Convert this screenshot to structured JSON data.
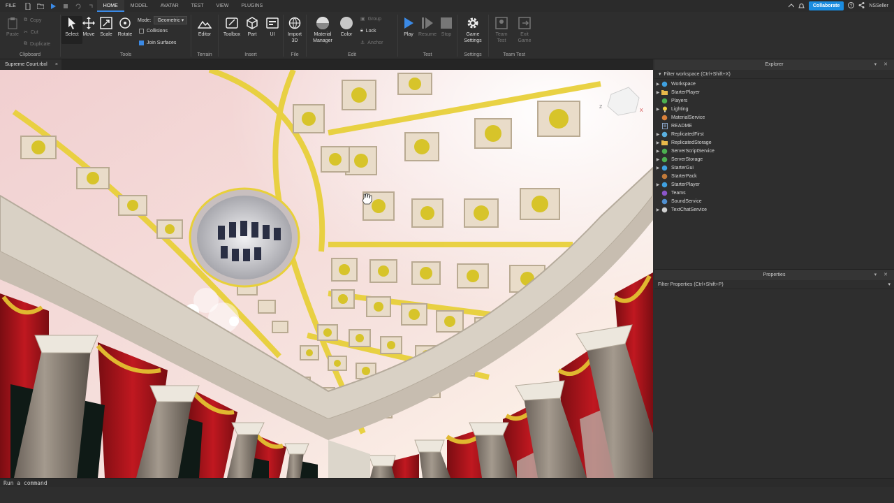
{
  "menubar": {
    "file_label": "FILE",
    "tabs": [
      "HOME",
      "MODEL",
      "AVATAR",
      "TEST",
      "VIEW",
      "PLUGINS"
    ],
    "collaborate_label": "Collaborate",
    "username": "NSSeller"
  },
  "ribbon": {
    "clipboard": {
      "paste": "Paste",
      "copy": "Copy",
      "cut": "Cut",
      "duplicate": "Duplicate",
      "label": "Clipboard"
    },
    "tools": {
      "select": "Select",
      "move": "Move",
      "scale": "Scale",
      "rotate": "Rotate",
      "mode_label": "Mode:",
      "mode_value": "Geometric",
      "collisions": "Collisions",
      "join_surfaces": "Join Surfaces",
      "label": "Tools"
    },
    "terrain": {
      "editor": "Editor",
      "label": "Terrain"
    },
    "insert": {
      "toolbox": "Toolbox",
      "part": "Part",
      "ui": "UI",
      "label": "Insert"
    },
    "file": {
      "import": "Import 3D",
      "label": "File"
    },
    "edit": {
      "material_manager": "Material Manager",
      "color": "Color",
      "group": "Group",
      "lock": "Lock",
      "anchor": "Anchor",
      "label": "Edit"
    },
    "test": {
      "play": "Play",
      "resume": "Resume",
      "stop": "Stop",
      "label": "Test"
    },
    "settings": {
      "game_settings": "Game Settings",
      "label": "Settings"
    },
    "team_test": {
      "team_test": "Team Test",
      "exit_game": "Exit Game",
      "label": "Team Test"
    }
  },
  "document_tab": {
    "title": "Supreme Court.rbxl",
    "close": "×"
  },
  "explorer": {
    "title": "Explorer",
    "filter_placeholder": "Filter workspace (Ctrl+Shift+X)",
    "items": [
      {
        "label": "Workspace",
        "icon": "workspace-icon",
        "expandable": true
      },
      {
        "label": "StarterPlayer",
        "icon": "folder-icon",
        "expandable": true
      },
      {
        "label": "Players",
        "icon": "players-icon",
        "expandable": false
      },
      {
        "label": "Lighting",
        "icon": "lighting-icon",
        "expandable": true
      },
      {
        "label": "MaterialService",
        "icon": "material-service-icon",
        "expandable": false
      },
      {
        "label": "README",
        "icon": "script-icon",
        "expandable": false
      },
      {
        "label": "ReplicatedFirst",
        "icon": "replicated-first-icon",
        "expandable": true
      },
      {
        "label": "ReplicatedStorage",
        "icon": "folder-icon",
        "expandable": true
      },
      {
        "label": "ServerScriptService",
        "icon": "server-script-service-icon",
        "expandable": true
      },
      {
        "label": "ServerStorage",
        "icon": "server-storage-icon",
        "expandable": true
      },
      {
        "label": "StarterGui",
        "icon": "starter-gui-icon",
        "expandable": true
      },
      {
        "label": "StarterPack",
        "icon": "starter-pack-icon",
        "expandable": false
      },
      {
        "label": "StarterPlayer",
        "icon": "starter-player-icon",
        "expandable": true
      },
      {
        "label": "Teams",
        "icon": "teams-icon",
        "expandable": false
      },
      {
        "label": "SoundService",
        "icon": "sound-service-icon",
        "expandable": false
      },
      {
        "label": "TextChatService",
        "icon": "text-chat-service-icon",
        "expandable": true
      }
    ]
  },
  "properties": {
    "title": "Properties",
    "filter_placeholder": "Filter Properties (Ctrl+Shift+P)"
  },
  "command_bar": {
    "placeholder": "Run a command"
  },
  "colors": {
    "accent": "#3b8ae6",
    "collaborate": "#1a8ce0"
  }
}
